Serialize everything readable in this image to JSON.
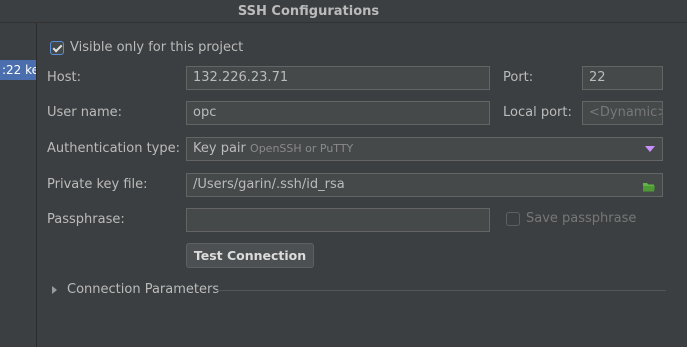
{
  "window": {
    "title": "SSH Configurations"
  },
  "sidebar": {
    "selected_item": ":22 ke"
  },
  "visible_only": {
    "label": "Visible only for this project",
    "checked": true
  },
  "host": {
    "label": "Host:",
    "value": "132.226.23.71"
  },
  "port": {
    "label": "Port:",
    "value": "22"
  },
  "username": {
    "label": "User name:",
    "value": "opc"
  },
  "local_port": {
    "label": "Local port:",
    "placeholder": "<Dynamic>"
  },
  "auth": {
    "label": "Authentication type:",
    "value": "Key pair",
    "hint": "OpenSSH or PuTTY"
  },
  "private_key": {
    "label": "Private key file:",
    "value": "/Users/garin/.ssh/id_rsa",
    "icon": "folder-icon"
  },
  "passphrase": {
    "label": "Passphrase:",
    "value": ""
  },
  "save_passphrase": {
    "label": "Save passphrase",
    "checked": false
  },
  "test_button": {
    "label": "Test Connection"
  },
  "connection_params": {
    "label": "Connection Parameters"
  },
  "colors": {
    "accent": "#4b6eaf",
    "background": "#3c3f41",
    "field": "#45494a"
  }
}
